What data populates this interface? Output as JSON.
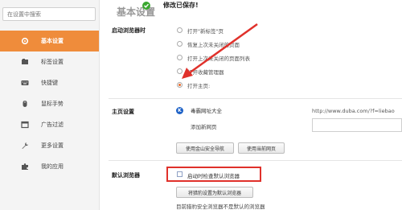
{
  "sidebar": {
    "search_placeholder": "在设置中搜索",
    "items": [
      {
        "label": "基本设置",
        "icon": "gear-icon",
        "active": true
      },
      {
        "label": "标签设置",
        "icon": "tab-icon",
        "active": false
      },
      {
        "label": "快捷键",
        "icon": "keyboard-icon",
        "active": false
      },
      {
        "label": "鼠标手势",
        "icon": "mouse-icon",
        "active": false
      },
      {
        "label": "广告过滤",
        "icon": "window-icon",
        "active": false
      },
      {
        "label": "更多设置",
        "icon": "wrench-icon",
        "active": false
      },
      {
        "label": "我的应用",
        "icon": "puzzle-icon",
        "active": false
      }
    ]
  },
  "toast": {
    "message": "修改已保存!"
  },
  "header_partial": "基本设置",
  "startup": {
    "label": "启动浏览器时",
    "options": [
      {
        "text": "打开\"新标签\"页",
        "checked": false
      },
      {
        "text": "恢复上次未关闭的页面",
        "checked": false
      },
      {
        "text": "打开上次未关闭的页面列表",
        "checked": false
      },
      {
        "text": "打开收藏管理器",
        "checked": false
      },
      {
        "text": "打开主页:",
        "checked": true
      }
    ]
  },
  "homepage": {
    "label": "主页设置",
    "entry_name": "毒霸网址大全",
    "entry_url": "http://www.duba.com/?f=liebao",
    "add_link": "添加新网页",
    "btn_nav": "使用金山安全导航",
    "btn_current": "使用当前网页"
  },
  "default_browser": {
    "label": "默认浏览器",
    "check_label": "启动时检查默认浏览器",
    "check_checked": false,
    "btn_set": "将猎豹设置为默认浏览器",
    "status": "目前猎豹安全浏览器不是默认的浏览器"
  },
  "colors": {
    "active": "#ef8c3b",
    "toast_check": "#3aa72f",
    "highlight": "#e0312b"
  }
}
